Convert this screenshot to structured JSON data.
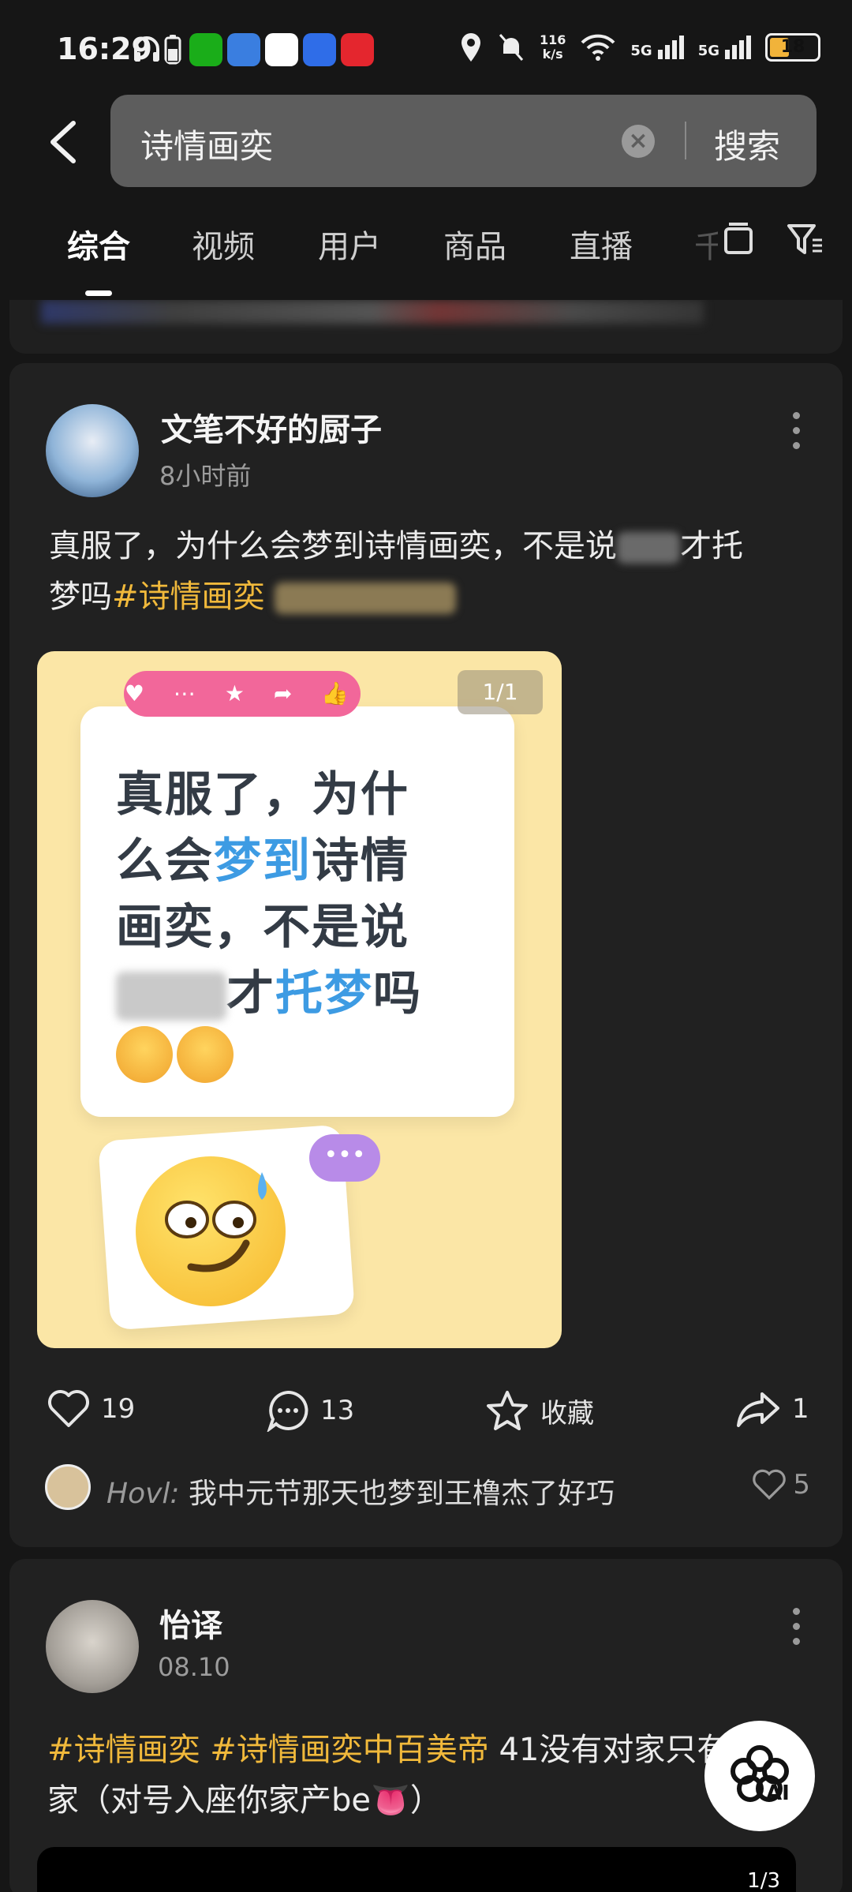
{
  "status_bar": {
    "time": "16:29",
    "net_speed_value": "116",
    "net_speed_unit": "k/s",
    "signal1": "5G",
    "signal2": "5G",
    "battery": "18"
  },
  "search": {
    "query": "诗情画奕",
    "button_label": "搜索"
  },
  "tabs": [
    {
      "label": "综合",
      "active": true
    },
    {
      "label": "视频"
    },
    {
      "label": "用户"
    },
    {
      "label": "商品"
    },
    {
      "label": "直播"
    },
    {
      "label": "千"
    }
  ],
  "post1": {
    "author": "文笔不好的厨子",
    "time": "8小时前",
    "text_line1": "真服了，为什么会梦到诗情画奕，不是说",
    "text_line1_tail": "才托",
    "text_line2": "梦吗",
    "hashtag": "#诗情画奕",
    "image": {
      "badge": "1/1",
      "line1": "真服了，为什",
      "line2_a": "么会",
      "line2_b": "梦到",
      "line2_c": "诗情",
      "line3": "画奕，不是说",
      "line4_a": "才",
      "line4_b": "托梦",
      "line4_c": "吗",
      "reaction_bar": "♥ ⋯ ★ ➦ 👍 +",
      "dots": "•••"
    },
    "actions": {
      "likes": "19",
      "comments": "13",
      "favorite_label": "收藏",
      "shares": "1"
    },
    "top_comment": {
      "user": "Hovl:",
      "text": "我中元节那天也梦到王橹杰了好巧",
      "likes": "5"
    }
  },
  "post2": {
    "author": "怡译",
    "time": "08.10",
    "hashtag1": "#诗情画奕",
    "hashtag2": "#诗情画奕中百美帝",
    "text_line1": " 41没有对家只有下",
    "text_line2": "家（对号入座你家产be",
    "text_line2_tail": "）",
    "tongue_emoji": "👅",
    "video_badge": "1/3"
  },
  "ai_button": {
    "label": "AI"
  },
  "colors": {
    "background": "#161616",
    "card": "#212121",
    "hashtag": "#f1b93b",
    "search_box": "#5d5d5d",
    "image_bg": "#fbe6a6",
    "highlight_blue": "#3d9be3"
  }
}
